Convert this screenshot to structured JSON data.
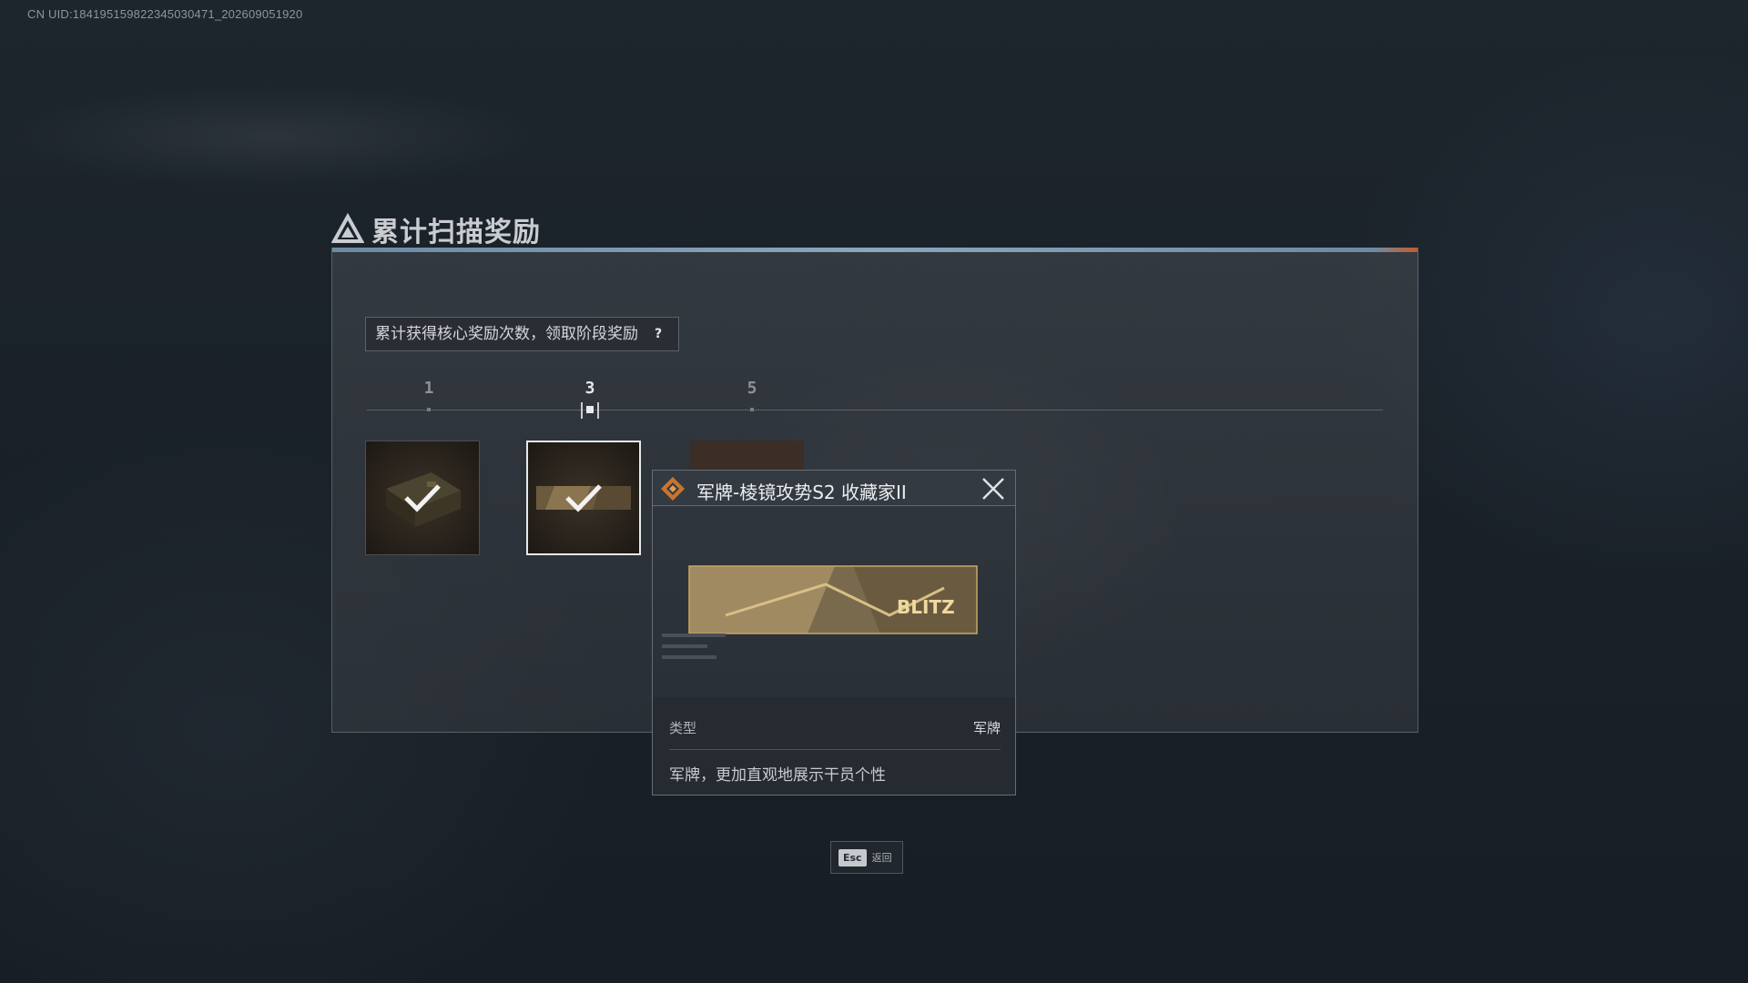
{
  "uid_text": "CN UID:1841951598223450304​71_202609051920",
  "title": "累计扫描奖励",
  "hint": {
    "text": "累计获得核心奖励次数，领取阶段奖励",
    "help": "?"
  },
  "milestones": [
    {
      "label": "1",
      "state": "claimed"
    },
    {
      "label": "3",
      "state": "current"
    },
    {
      "label": "5",
      "state": "locked"
    }
  ],
  "rewards": [
    {
      "name": "supply-crate",
      "claimed": true
    },
    {
      "name": "military-tag",
      "claimed": true,
      "selected": true
    },
    {
      "name": "locked-reward",
      "claimed": false
    }
  ],
  "tooltip": {
    "title": "军牌-棱镜攻势S2 收藏家II",
    "type_label": "类型",
    "type_value": "军牌",
    "description": "军牌，更加直观地展示干员个性",
    "banner_text": "BLITZ"
  },
  "esc": {
    "key": "Esc",
    "label": "返回"
  },
  "colors": {
    "accent_bar": "#8aa6bd",
    "accent_orange": "#c55a2b",
    "selected_border": "#e8e8e8"
  }
}
